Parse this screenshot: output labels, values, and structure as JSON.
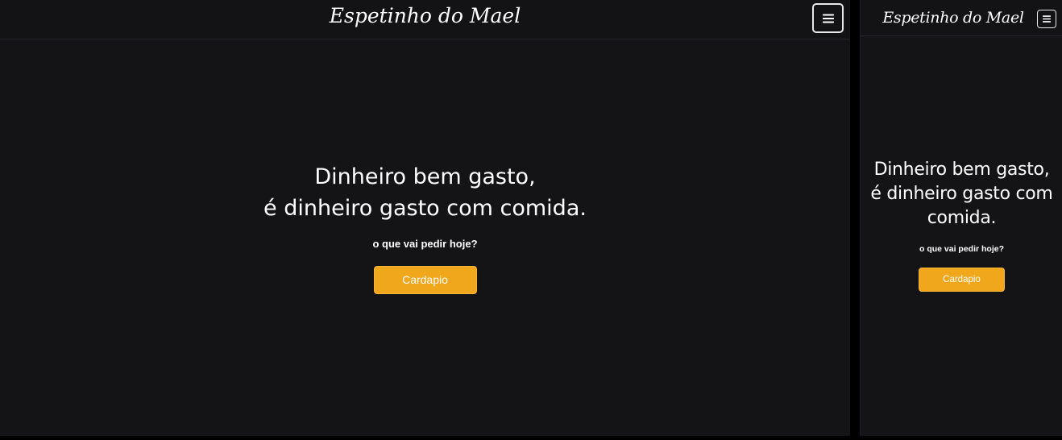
{
  "brand": "Espetinho do Mael",
  "menu_icon": "hamburger-menu-icon",
  "hero": {
    "line1": "Dinheiro bem gasto,",
    "line2": "é dinheiro gasto com comida.",
    "subtitle": "o que vai pedir hoje?",
    "button_label": "Cardapio"
  },
  "colors": {
    "background": "#141416",
    "accent": "#f0a71c",
    "text": "#ffffff"
  }
}
